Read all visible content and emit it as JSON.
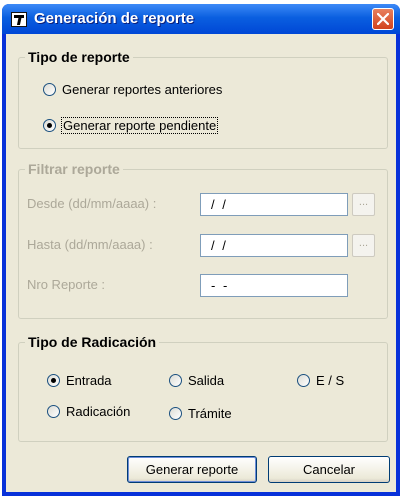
{
  "window": {
    "title": "Generación de reporte"
  },
  "tipo_reporte": {
    "legend": "Tipo de reporte",
    "options": [
      {
        "label": "Generar reportes anteriores",
        "selected": false
      },
      {
        "label": "Generar reporte pendiente",
        "selected": true
      }
    ]
  },
  "filtrar_reporte": {
    "legend": "Filtrar reporte",
    "desde_label": "Desde (dd/mm/aaaa) :",
    "desde_value": "/ /",
    "hasta_label": "Hasta (dd/mm/aaaa) :",
    "hasta_value": "/ /",
    "nro_label": "Nro Reporte :",
    "nro_value": "- -",
    "browse_label": "..."
  },
  "tipo_radicacion": {
    "legend": "Tipo de Radicación",
    "options": [
      {
        "label": "Entrada",
        "selected": true
      },
      {
        "label": "Salida",
        "selected": false
      },
      {
        "label": "E / S",
        "selected": false
      },
      {
        "label": "Radicación",
        "selected": false
      },
      {
        "label": "Trámite",
        "selected": false
      }
    ]
  },
  "buttons": {
    "generate": "Generar reporte",
    "cancel": "Cancelar"
  }
}
